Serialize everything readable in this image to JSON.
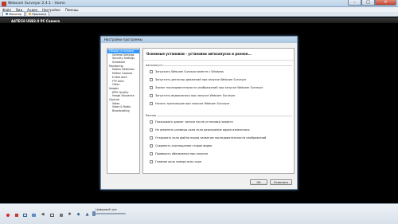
{
  "window": {
    "title": "Webcam Surveyor 2.4.1 - Home"
  },
  "menu": [
    "Файл",
    "Вид",
    "Аудио",
    "Настройки",
    "Помощь"
  ],
  "tabs": [
    {
      "label": "Монитор",
      "active": true
    },
    {
      "label": "Просмотр",
      "active": false
    }
  ],
  "camera": {
    "name": "A4TECH USB2.0 PC Camera"
  },
  "dialog": {
    "title": "Настройки программы",
    "heading": "Основные установки - установки автозапуска и разное...",
    "tree": [
      {
        "label": "Общие установки",
        "level": 0,
        "selected": true
      },
      {
        "label": "General Settings",
        "level": 1
      },
      {
        "label": "Security Settings",
        "level": 1
      },
      {
        "label": "Scheduler",
        "level": 1
      },
      {
        "label": "Monitoring",
        "level": 0
      },
      {
        "label": "Motion Detection",
        "level": 1
      },
      {
        "label": "Motion Capture",
        "level": 1
      },
      {
        "label": "E-Mail Alert",
        "level": 1
      },
      {
        "label": "FTP Alert",
        "level": 1
      },
      {
        "label": "Other",
        "level": 1
      },
      {
        "label": "Images",
        "level": 0
      },
      {
        "label": "JPEG Quality",
        "level": 1
      },
      {
        "label": "Image Sequence",
        "level": 1
      },
      {
        "label": "Capture",
        "level": 0
      },
      {
        "label": "Video",
        "level": 1
      },
      {
        "label": "Video & Radio",
        "level": 1
      },
      {
        "label": "Broadcasting",
        "level": 1
      }
    ],
    "autostart": {
      "title": "Автозапуск",
      "options": [
        {
          "label": "Запускать Webcam Surveyor вместе с Windows",
          "checked": false
        },
        {
          "label": "Запустить детектор движений при запуске Webcam Surveyor",
          "checked": false
        },
        {
          "label": "Захват последовательности изображений при запуске Webcam Surveyor",
          "checked": false
        },
        {
          "label": "Запустить видеозапись при запуске Webcam Surveyor",
          "checked": false
        },
        {
          "label": "Начать трансляцию при запуске Webcam Surveyor",
          "checked": false
        }
      ]
    },
    "misc": {
      "title": "Разное",
      "options": [
        {
          "label": "Показывать диалог записи после установки захвата",
          "checked": false
        },
        {
          "label": "Не изменять размеры окна если разрешение видео изменилось",
          "checked": false
        },
        {
          "label": "Открывать окно файла перед захватом последовательности изображений",
          "checked": false
        },
        {
          "label": "Сохранять соотношение сторон видео",
          "checked": true
        },
        {
          "label": "Проверять обновления при запуске",
          "checked": false
        },
        {
          "label": "Главное окно поверх всех окон",
          "checked": false
        }
      ]
    },
    "buttons": {
      "ok": "OK",
      "cancel": "Отменить"
    }
  },
  "statusbar": {
    "label": "Цифровой зум",
    "zoom": 0.0,
    "controls": [
      "record-icon",
      "stop-icon",
      "snapshot-icon",
      "image-icon",
      "mute-icon",
      "fullscreen-icon",
      "lock-icon",
      "settings-icon",
      "timer-icon",
      "broadcast-icon",
      "ftp-icon",
      "mail-icon"
    ]
  },
  "colors": {
    "record": "#d62b2b",
    "accent": "#3399ff",
    "titlebar": "#b9d1e8"
  }
}
